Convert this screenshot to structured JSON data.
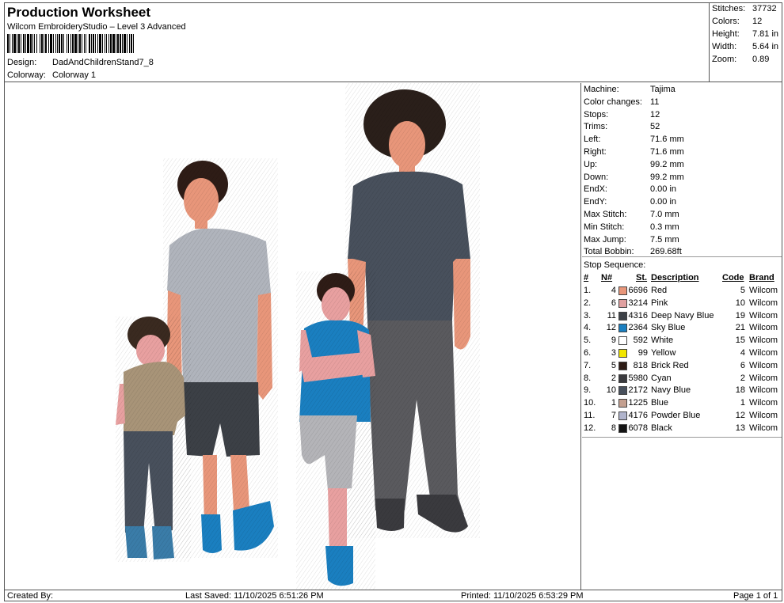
{
  "header": {
    "title": "Production Worksheet",
    "subtitle": "Wilcom EmbroideryStudio – Level 3 Advanced",
    "design_label": "Design:",
    "design_value": "DadAndChildrenStand7_8",
    "colorway_label": "Colorway:",
    "colorway_value": "Colorway 1"
  },
  "stats": [
    {
      "label": "Stitches:",
      "value": "37732"
    },
    {
      "label": "Colors:",
      "value": "12"
    },
    {
      "label": "Height:",
      "value": "7.81 in"
    },
    {
      "label": "Width:",
      "value": "5.64 in"
    },
    {
      "label": "Zoom:",
      "value": "0.89"
    }
  ],
  "info": [
    {
      "label": "Machine:",
      "value": "Tajima"
    },
    {
      "label": "Color changes:",
      "value": "11"
    },
    {
      "label": "Stops:",
      "value": "12"
    },
    {
      "label": "Trims:",
      "value": "52"
    },
    {
      "label": "Left:",
      "value": "71.6 mm"
    },
    {
      "label": "Right:",
      "value": "71.6 mm"
    },
    {
      "label": "Up:",
      "value": "99.2 mm"
    },
    {
      "label": "Down:",
      "value": "99.2 mm"
    },
    {
      "label": "EndX:",
      "value": "0.00 in"
    },
    {
      "label": "EndY:",
      "value": "0.00 in"
    },
    {
      "label": "Max Stitch:",
      "value": "7.0 mm"
    },
    {
      "label": "Min Stitch:",
      "value": "0.3 mm"
    },
    {
      "label": "Max Jump:",
      "value": "7.5 mm"
    },
    {
      "label": "Total Bobbin:",
      "value": "269.68ft"
    }
  ],
  "stop_sequence": {
    "title": "Stop Sequence:",
    "headers": {
      "stop": "#",
      "needle": "N#",
      "stitches": "St.",
      "description": "Description",
      "code": "Code",
      "brand": "Brand"
    },
    "rows": [
      {
        "stop": "1.",
        "needle": "4",
        "color": "#e8967a",
        "stitches": "6696",
        "description": "Red",
        "code": "5",
        "brand": "Wilcom"
      },
      {
        "stop": "2.",
        "needle": "6",
        "color": "#e0a0a0",
        "stitches": "3214",
        "description": "Pink",
        "code": "10",
        "brand": "Wilcom"
      },
      {
        "stop": "3.",
        "needle": "11",
        "color": "#3c4046",
        "stitches": "4316",
        "description": "Deep Navy Blue",
        "code": "19",
        "brand": "Wilcom"
      },
      {
        "stop": "4.",
        "needle": "12",
        "color": "#1a7fc0",
        "stitches": "2364",
        "description": "Sky Blue",
        "code": "21",
        "brand": "Wilcom"
      },
      {
        "stop": "5.",
        "needle": "9",
        "color": "#ffffff",
        "stitches": "592",
        "description": "White",
        "code": "15",
        "brand": "Wilcom"
      },
      {
        "stop": "6.",
        "needle": "3",
        "color": "#f2e600",
        "stitches": "99",
        "description": "Yellow",
        "code": "4",
        "brand": "Wilcom"
      },
      {
        "stop": "7.",
        "needle": "5",
        "color": "#2e1c16",
        "stitches": "818",
        "description": "Brick Red",
        "code": "6",
        "brand": "Wilcom"
      },
      {
        "stop": "8.",
        "needle": "2",
        "color": "#3a3a3e",
        "stitches": "5980",
        "description": "Cyan",
        "code": "2",
        "brand": "Wilcom"
      },
      {
        "stop": "9.",
        "needle": "10",
        "color": "#48505c",
        "stitches": "2172",
        "description": "Navy Blue",
        "code": "18",
        "brand": "Wilcom"
      },
      {
        "stop": "10.",
        "needle": "1",
        "color": "#c4a090",
        "stitches": "1225",
        "description": "Blue",
        "code": "1",
        "brand": "Wilcom"
      },
      {
        "stop": "11.",
        "needle": "7",
        "color": "#b0b4cc",
        "stitches": "4176",
        "description": "Powder Blue",
        "code": "12",
        "brand": "Wilcom"
      },
      {
        "stop": "12.",
        "needle": "8",
        "color": "#141414",
        "stitches": "6078",
        "description": "Black",
        "code": "13",
        "brand": "Wilcom"
      }
    ]
  },
  "footer": {
    "created_by": "Created By:",
    "last_saved": "Last Saved: 11/10/2025 6:51:26 PM",
    "printed": "Printed: 11/10/2025 6:53:29 PM",
    "page": "Page 1 of 1"
  }
}
